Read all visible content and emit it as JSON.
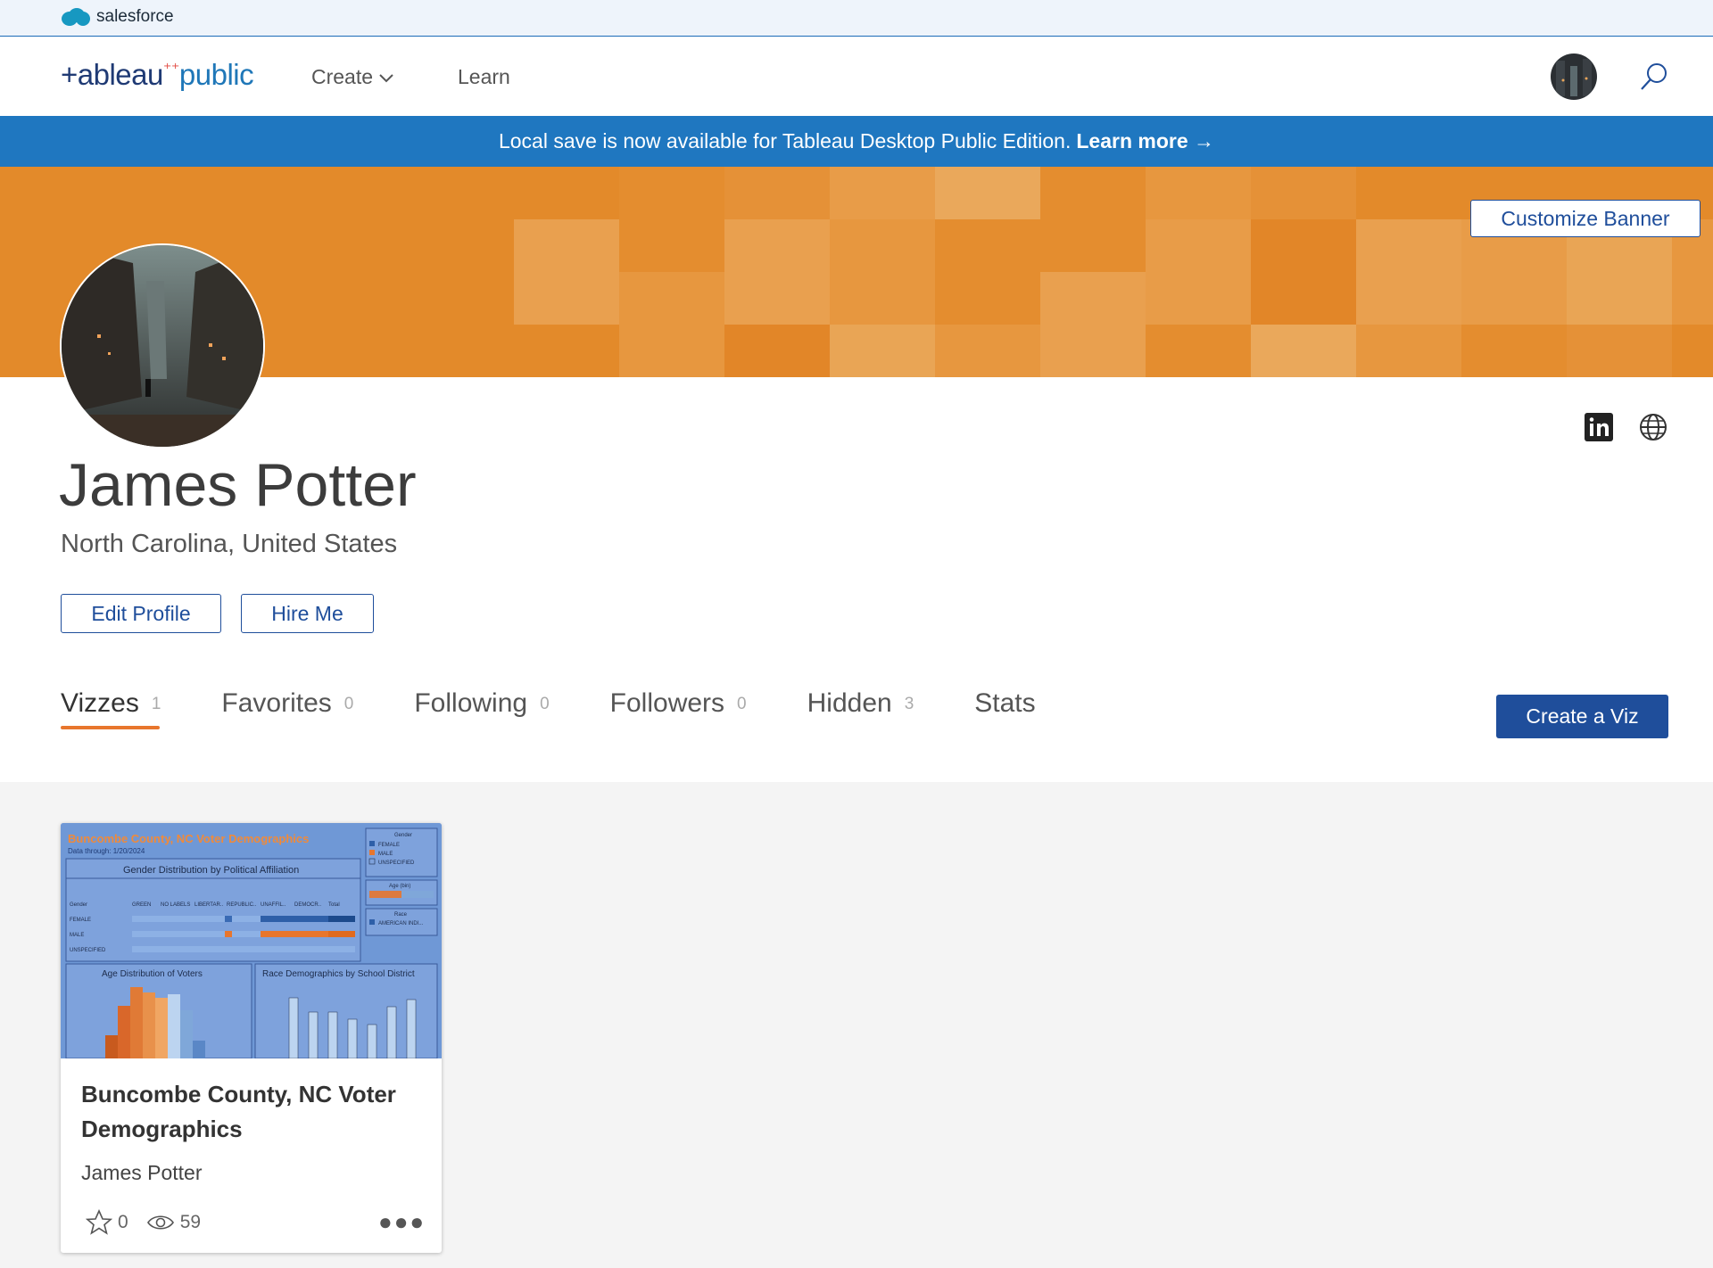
{
  "salesforce": {
    "logo_text": "salesforce"
  },
  "nav": {
    "logo": {
      "part1": "+ableau",
      "part2": "public"
    },
    "create_label": "Create",
    "learn_label": "Learn"
  },
  "announcement": {
    "text": "Local save is now available for Tableau Desktop Public Edition.",
    "link": "Learn more →"
  },
  "banner": {
    "customize_label": "Customize Banner",
    "color": "#e38a2a"
  },
  "profile": {
    "name": "James Potter",
    "location": "North Carolina, United States",
    "edit_label": "Edit Profile",
    "hire_label": "Hire Me"
  },
  "tabs": [
    {
      "label": "Vizzes",
      "count": "1"
    },
    {
      "label": "Favorites",
      "count": "0"
    },
    {
      "label": "Following",
      "count": "0"
    },
    {
      "label": "Followers",
      "count": "0"
    },
    {
      "label": "Hidden",
      "count": "3"
    },
    {
      "label": "Stats",
      "count": ""
    }
  ],
  "create_viz_label": "Create a Viz",
  "viz_card": {
    "title": "Buncombe County, NC Voter Demographics",
    "author": "James Potter",
    "favorites": "0",
    "views": "59",
    "thumbnail": {
      "title": "Buncombe County, NC Voter Demographics",
      "subtitle": "Data through: 1/20/2024",
      "section1": "Gender Distribution by Political Affiliation",
      "section2": "Age Distribution of Voters",
      "section3": "Race Demographics by School District",
      "legend_gender": "Gender",
      "legend_female": "FEMALE",
      "legend_male": "MALE",
      "legend_unspecified": "UNSPECIFIED",
      "legend_age": "Age (bin)",
      "legend_race": "Race",
      "legend_race_item": "AMERICAN INDI..."
    }
  },
  "colors": {
    "accent_blue": "#1f4e9b",
    "tab_underline": "#e8762d",
    "announcement": "#1f77c0"
  }
}
